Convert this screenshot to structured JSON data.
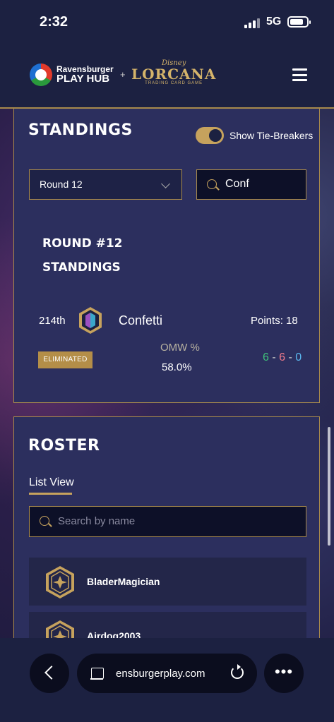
{
  "status_bar": {
    "time": "2:32",
    "network": "5G"
  },
  "header": {
    "logo_line1": "Ravensburger",
    "logo_line2": "PLAY HUB",
    "plus": "+",
    "lorcana_top": "Disney",
    "lorcana_name": "LORCANA",
    "lorcana_sub": "TRADING CARD GAME"
  },
  "standings": {
    "title": "STANDINGS",
    "toggle_label": "Show Tie-Breakers",
    "toggle_on": true,
    "round_select": "Round 12",
    "search_value": "Conf",
    "heading_line1": "ROUND #12",
    "heading_line2": "STANDINGS",
    "player": {
      "rank": "214th",
      "name": "Confetti",
      "points": "Points: 18",
      "status": "ELIMINATED",
      "omw_label": "OMW %",
      "omw_value": "58.0%",
      "wins": "6",
      "losses": "6",
      "draws": "0",
      "sep": "-"
    }
  },
  "roster": {
    "title": "ROSTER",
    "tab": "List View",
    "search_placeholder": "Search by name",
    "players": [
      {
        "name": "BladerMagician"
      },
      {
        "name": "Airdog2003"
      }
    ]
  },
  "browser": {
    "url": "ensburgerplay.com",
    "more": "•••"
  },
  "colors": {
    "accent_gold": "#a88a4c",
    "card_bg": "#2c2f5e",
    "win": "#3fc17a",
    "loss": "#f07a8a",
    "draw": "#5ab8f0"
  }
}
